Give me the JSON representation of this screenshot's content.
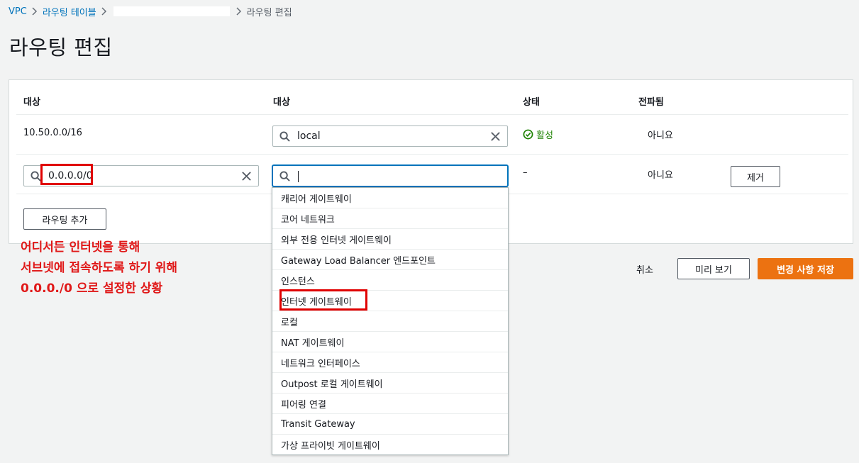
{
  "breadcrumb": {
    "vpc": "VPC",
    "route_tables": "라우팅 테이블",
    "current": "라우팅 편집"
  },
  "page_title": "라우팅 편집",
  "table": {
    "headers": [
      "대상",
      "대상",
      "상태",
      "전파됨"
    ],
    "rows": [
      {
        "destination": "10.50.0.0/16",
        "target": "local",
        "status": "활성",
        "propagated": "아니요"
      },
      {
        "destination": "0.0.0.0/0",
        "target": "",
        "status": "–",
        "propagated": "아니요",
        "remove_label": "제거"
      }
    ],
    "add_route_label": "라우팅 추가"
  },
  "dropdown": {
    "options": [
      "캐리어 게이트웨이",
      "코어 네트워크",
      "외부 전용 인터넷 게이트웨이",
      "Gateway Load Balancer 엔드포인트",
      "인스턴스",
      "인터넷 게이트웨이",
      "로컬",
      "NAT 게이트웨이",
      "네트워크 인터페이스",
      "Outpost 로컬 게이트웨이",
      "피어링 연결",
      "Transit Gateway",
      "가상 프라이빗 게이트웨이"
    ]
  },
  "actions": {
    "cancel": "취소",
    "preview": "미리 보기",
    "save": "변경 사항 저장"
  },
  "annotation": {
    "lines": [
      "어디서든 인터넷을 통해",
      "서브넷에 접속하도록 하기 위해",
      "0.0.0./0 으로 설정한 상황"
    ]
  },
  "colors": {
    "link": "#0073bb",
    "primary": "#ec7211",
    "success": "#1d8102",
    "annotation": "#e01818"
  }
}
